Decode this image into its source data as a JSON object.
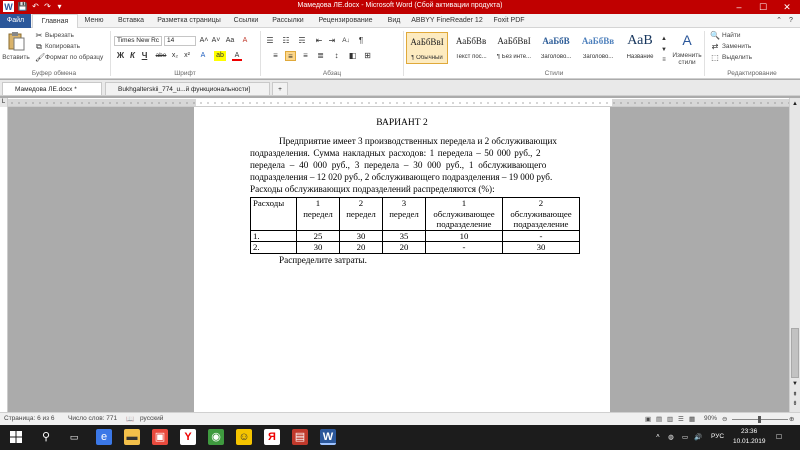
{
  "titlebar": {
    "title": "Мамедова ЛЕ.docx  -  Microsoft Word (Сбой активации продукта)",
    "min_icon": "minimize-icon",
    "max_icon": "maximize-icon",
    "close_icon": "close-icon",
    "min_glyph": "–",
    "max_glyph": "☐",
    "close_glyph": "✕",
    "save_glyph": "💾",
    "undo_glyph": "↶",
    "redo_glyph": "↷",
    "qa_more_glyph": "▾",
    "help_glyph": "?",
    "ribbon_toggle_glyph": "⌃"
  },
  "tabs": [
    "Файл",
    "Главная",
    "Меню",
    "Вставка",
    "Разметка страницы",
    "Ссылки",
    "Рассылки",
    "Рецензирование",
    "Вид",
    "ABBYY FineReader 12",
    "Foxit PDF"
  ],
  "ribbon": {
    "clipboard": {
      "paste": "Вставить",
      "cut": "Вырезать",
      "copy": "Копировать",
      "format_painter": "Формат по образцу",
      "label": "Буфер обмена"
    },
    "font": {
      "font_name": "Times New Rc",
      "font_size": "14",
      "label": "Шрифт",
      "bold": "Ж",
      "italic": "К",
      "underline": "Ч",
      "strike": "abe",
      "subscript": "x₂",
      "superscript": "x²",
      "grow": "A˄",
      "shrink": "A˅",
      "change_case": "Aa",
      "clear_format": "A",
      "highlight": "ab",
      "font_color": "A"
    },
    "paragraph": {
      "label": "Абзац",
      "pilcrow": "¶",
      "sort": "A↓"
    },
    "styles": {
      "label": "Стили",
      "items": [
        {
          "sample": "АаБбВвІ",
          "name": "¶ Обычный"
        },
        {
          "sample": "АаБбВв",
          "name": "Текст пос..."
        },
        {
          "sample": "АаБбВвІ",
          "name": "¶ Без инте..."
        },
        {
          "sample": "АаБбВ",
          "name": "Заголово..."
        },
        {
          "sample": "АаБбВв",
          "name": "Заголово..."
        },
        {
          "sample": "АаВ",
          "name": "Название"
        }
      ],
      "change_styles": "Изменить стили"
    },
    "editing": {
      "label": "Редактирование",
      "find": "Найти",
      "replace": "Заменить",
      "select": "Выделить"
    }
  },
  "doc_tabs": [
    {
      "label": "Мамедова ЛЕ.docx  *"
    },
    {
      "label": "Bukhgalterskii_774_u...й функциональности]"
    }
  ],
  "document": {
    "heading": "ВАРИАНТ 2",
    "paragraph_lines": [
      "Предприятие имеет 3 производственных передела и 2 обслуживающих",
      "подразделения. Сумма накладных расходов: 1 передела – 50 000 руб., 2",
      "передела – 40 000 руб., 3 передела – 30 000 руб., 1 обслуживающего",
      "подразделения – 12 020 руб., 2 обслуживающего подразделения – 19 000 руб.",
      "Расходы обслуживающих подразделений распределяются (%):"
    ],
    "table": {
      "headers": [
        [
          "Расходы"
        ],
        [
          "1",
          "передел"
        ],
        [
          "2",
          "передел"
        ],
        [
          "3",
          "передел"
        ],
        [
          "1",
          "обслуживающее",
          "подразделение"
        ],
        [
          "2",
          "обслуживающее",
          "подразделение"
        ]
      ],
      "rows": [
        [
          "1.",
          "25",
          "30",
          "35",
          "10",
          "-"
        ],
        [
          "2.",
          "30",
          "20",
          "20",
          "-",
          "30"
        ]
      ]
    },
    "closing": "Распределите затраты."
  },
  "statusbar": {
    "page": "Страница: 6 из 6",
    "words": "Число слов: 771",
    "language": "русский",
    "zoom": "90%"
  },
  "taskbar": {
    "time": "23:36",
    "date": "10.01.2019",
    "lang": "РУС"
  },
  "colors": {
    "titlebar": "#c00000",
    "file_tab": "#2b579a",
    "taskbar": "#1c1c1c"
  }
}
